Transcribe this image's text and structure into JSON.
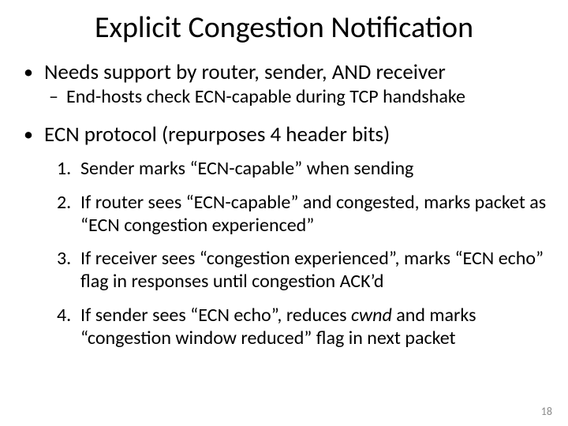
{
  "title": "Explicit Congestion Notification",
  "b1": {
    "text": "Needs support by router, sender, AND receiver",
    "sub": "End-hosts check ECN-capable during TCP handshake"
  },
  "b2": {
    "text": "ECN protocol (repurposes 4 header bits)",
    "items": {
      "n1": "Sender marks “ECN-capable” when sending",
      "n2": "If router sees “ECN-capable” and congested, marks packet as “ECN congestion experienced”",
      "n3": "If receiver sees “congestion experienced”, marks “ECN echo” flag in responses until congestion ACK’d",
      "n4a": "If sender sees “ECN echo”, reduces ",
      "n4b": "cwnd",
      "n4c": " and marks “congestion window reduced” flag in next packet"
    }
  },
  "bullet": "•",
  "dash": "–",
  "nums": {
    "n1": "1.",
    "n2": "2.",
    "n3": "3.",
    "n4": "4."
  },
  "page": "18"
}
